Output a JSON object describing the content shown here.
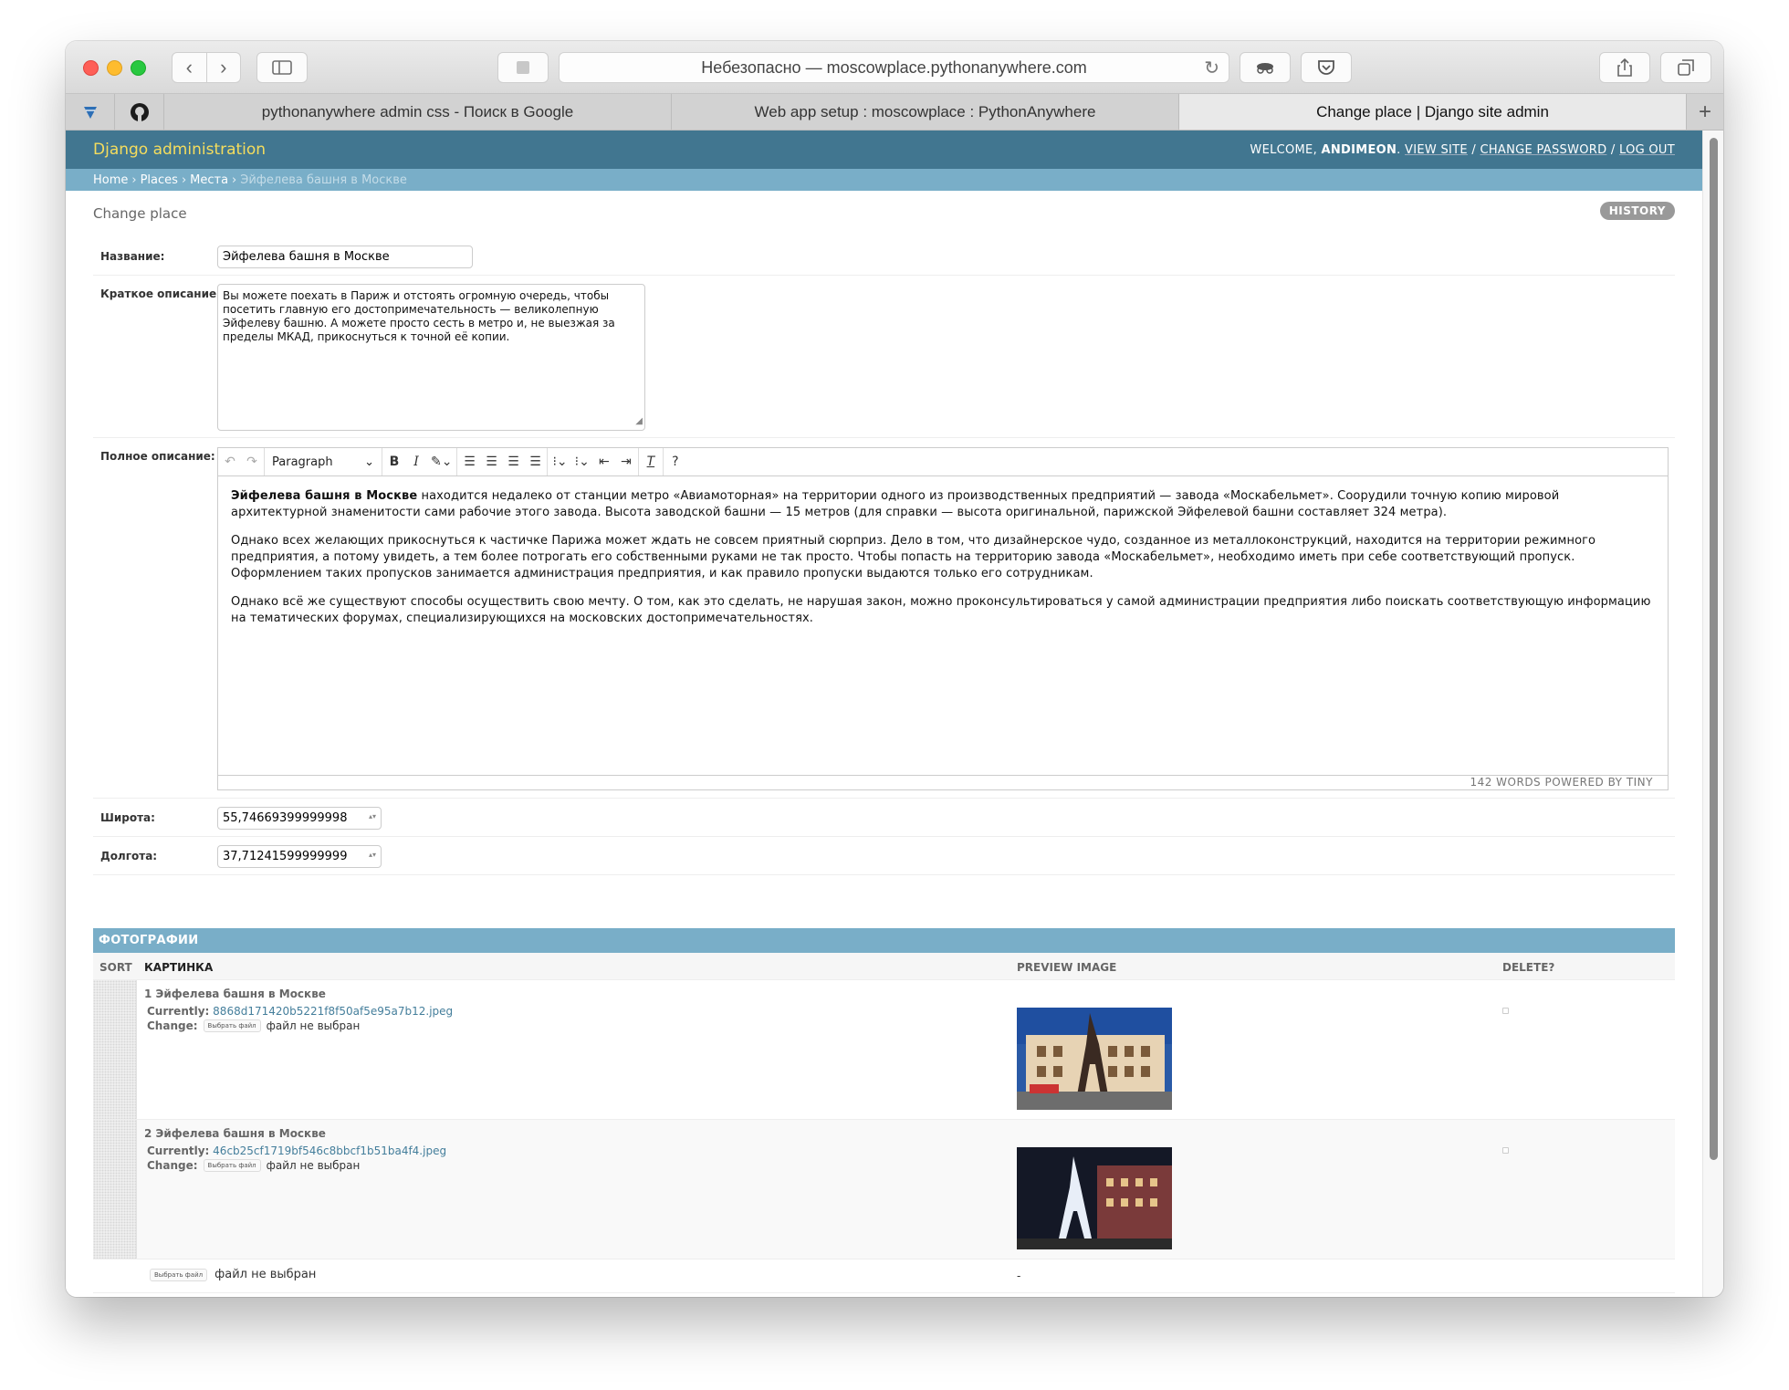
{
  "browser": {
    "address": "Небезопасно — moscowplace.pythonanywhere.com",
    "tabs": [
      {
        "label": "pythonanywhere admin css - Поиск в Google"
      },
      {
        "label": "Web app setup : moscowplace : PythonAnywhere"
      },
      {
        "label": "Change place | Django site admin"
      }
    ]
  },
  "header": {
    "brand": "Django administration",
    "welcome": "WELCOME,",
    "user": "ANDIMEON",
    "view_site": "VIEW SITE",
    "change_password": "CHANGE PASSWORD",
    "log_out": "LOG OUT",
    "sep": "/"
  },
  "breadcrumbs": {
    "home": "Home",
    "places": "Places",
    "mesta": "Места",
    "current": "Эйфелева башня в Москве"
  },
  "page": {
    "title": "Change place",
    "history": "HISTORY"
  },
  "form": {
    "name_label": "Название:",
    "name_value": "Эйфелева башня в Москве",
    "short_label": "Краткое описание:",
    "short_value": "Вы можете поехать в Париж и отстоять огромную очередь, чтобы\nпосетить главную его достопримечательность — великолепную\nЭйфелеву башню. А можете просто сесть в метро и, не выезжая за\nпределы МКАД, прикоснуться к точной её копии.",
    "full_label": "Полное описание:",
    "lat_label": "Широта:",
    "lat_value": "55,74669399999998",
    "lng_label": "Долгота:",
    "lng_value": "37,71241599999999"
  },
  "editor": {
    "block_format": "Paragraph",
    "p1_bold": "Эйфелева башня в Москве",
    "p1_rest": " находится недалеко от станции метро «Авиамоторная» на территории одного из производственных предприятий — завода «Москабельмет». Соорудили точную копию мировой архитектурной знаменитости сами рабочие этого завода. Высота заводской башни — 15 метров (для справки — высота оригинальной, парижской Эйфелевой башни составляет 324 метра).",
    "p2": "Однако всех желающих прикоснуться к частичке Парижа может ждать не совсем приятный сюрприз. Дело в том, что дизайнерское чудо, созданное из металлоконструкций, находится на территории режимного предприятия, а потому увидеть, а тем более потрогать его собственными руками не так просто. Чтобы попасть на территорию завода «Москабельмет», необходимо иметь при себе соответствующий пропуск. Оформлением таких пропусков занимается администрация предприятия, и как правило пропуски выдаются только его сотрудникам.",
    "p3": "Однако всё же существуют способы осуществить свою мечту. О том, как это сделать, не нарушая закон, можно проконсультироваться у самой администрации предприятия либо поискать соответствующую информацию на тематических форумах, специализирующихся на московских достопримечательностях.",
    "status": "142 WORDS  POWERED BY TINY"
  },
  "inline": {
    "heading": "ФОТОГРАФИИ",
    "col_sort": "SORT",
    "col_image": "КАРТИНКА",
    "col_preview": "PREVIEW IMAGE",
    "col_delete": "DELETE?",
    "currently": "Currently:",
    "change": "Change:",
    "file_button": "Выбрать файл",
    "no_file": "файл не выбран",
    "dash": "-",
    "rows": [
      {
        "title": "1 Эйфелева башня в Москве",
        "file": "8868d171420b5221f8f50af5e95a7b12.jpeg"
      },
      {
        "title": "2 Эйфелева башня в Москве",
        "file": "46cb25cf1719bf546c8bbcf1b51ba4f4.jpeg"
      }
    ]
  }
}
